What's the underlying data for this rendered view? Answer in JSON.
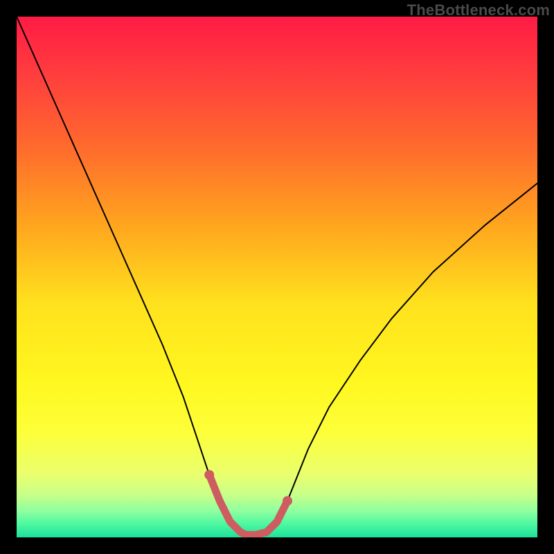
{
  "watermark": "TheBottleneck.com",
  "colors": {
    "frame": "#000000",
    "curve": "#000000",
    "segment": "#cd5d60",
    "segment_dot": "#cd5d60"
  },
  "chart_data": {
    "type": "line",
    "title": "",
    "xlabel": "",
    "ylabel": "",
    "xlim": [
      0,
      100
    ],
    "ylim": [
      0,
      100
    ],
    "grid": false,
    "gradient_stops": [
      {
        "offset": 0.0,
        "color": "#ff1b44"
      },
      {
        "offset": 0.1,
        "color": "#ff3a3f"
      },
      {
        "offset": 0.25,
        "color": "#ff6a2d"
      },
      {
        "offset": 0.4,
        "color": "#ffa51e"
      },
      {
        "offset": 0.55,
        "color": "#ffe11e"
      },
      {
        "offset": 0.7,
        "color": "#fff71f"
      },
      {
        "offset": 0.8,
        "color": "#fdff3a"
      },
      {
        "offset": 0.88,
        "color": "#e9ff6e"
      },
      {
        "offset": 0.92,
        "color": "#c6ff8a"
      },
      {
        "offset": 0.95,
        "color": "#8dffa0"
      },
      {
        "offset": 0.975,
        "color": "#4cf7a0"
      },
      {
        "offset": 1.0,
        "color": "#1be29a"
      }
    ],
    "series": [
      {
        "name": "bottleneck-curve",
        "x": [
          0,
          4,
          8,
          12,
          16,
          20,
          24,
          28,
          32,
          35,
          37,
          39,
          41,
          43,
          44,
          46,
          48,
          50,
          52,
          54,
          56,
          60,
          66,
          72,
          80,
          90,
          100
        ],
        "values": [
          100,
          91,
          82,
          73,
          64,
          55,
          46,
          37,
          27,
          18,
          12,
          7,
          3,
          1,
          0.5,
          0.5,
          1,
          3,
          7,
          12,
          17,
          25,
          34,
          42,
          51,
          60,
          68
        ]
      }
    ],
    "highlight_segment": {
      "name": "optimal-range",
      "x_range": [
        37,
        52
      ],
      "points": [
        {
          "x": 37,
          "y": 12
        },
        {
          "x": 39,
          "y": 7
        },
        {
          "x": 41,
          "y": 3
        },
        {
          "x": 43,
          "y": 1
        },
        {
          "x": 44,
          "y": 0.5
        },
        {
          "x": 46,
          "y": 0.5
        },
        {
          "x": 48,
          "y": 1
        },
        {
          "x": 50,
          "y": 3
        },
        {
          "x": 52,
          "y": 7
        }
      ]
    }
  }
}
